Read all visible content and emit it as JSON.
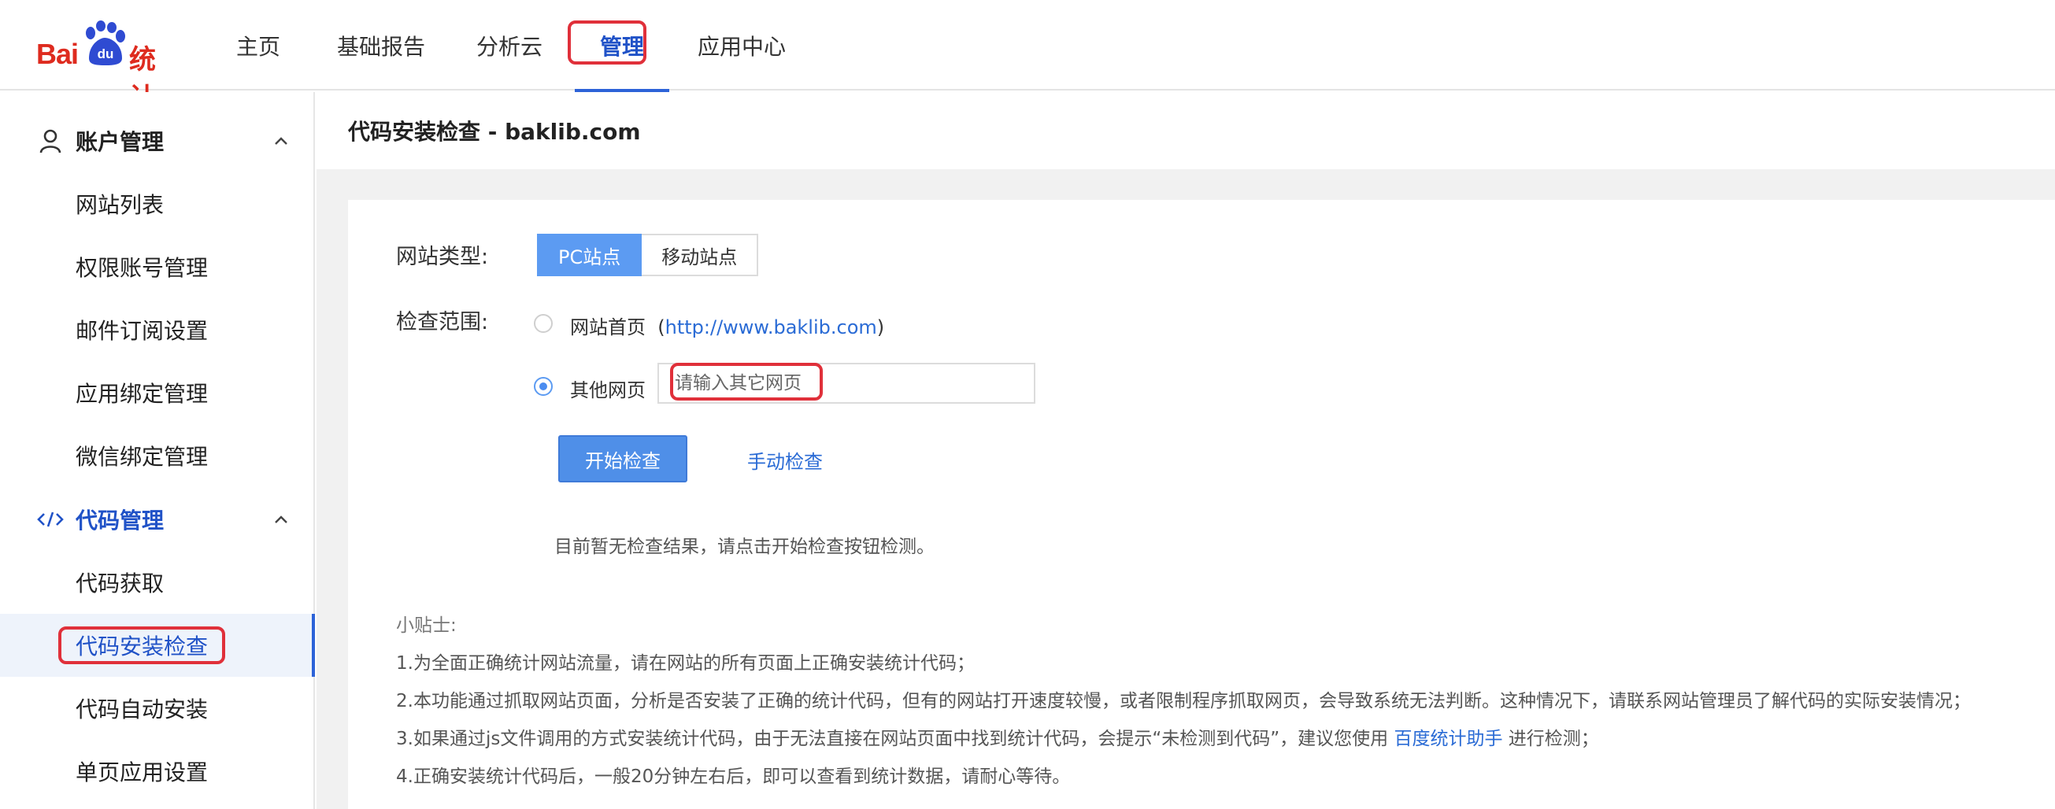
{
  "brand": {
    "logo_text_latin": "Bai",
    "logo_text_du": "du",
    "logo_text_cn": "统计",
    "color": "#de2b1f"
  },
  "nav": {
    "items": [
      {
        "label": "主页"
      },
      {
        "label": "基础报告"
      },
      {
        "label": "分析云"
      },
      {
        "label": "管理",
        "active": true
      },
      {
        "label": "应用中心"
      }
    ]
  },
  "sidebar": {
    "groups": [
      {
        "label": "账户管理",
        "icon": "user-icon",
        "items": [
          {
            "label": "网站列表"
          },
          {
            "label": "权限账号管理"
          },
          {
            "label": "邮件订阅设置"
          },
          {
            "label": "应用绑定管理"
          },
          {
            "label": "微信绑定管理"
          }
        ]
      },
      {
        "label": "代码管理",
        "icon": "code-icon",
        "items": [
          {
            "label": "代码获取"
          },
          {
            "label": "代码安装检查",
            "active": true
          },
          {
            "label": "代码自动安装"
          },
          {
            "label": "单页应用设置"
          }
        ]
      }
    ]
  },
  "page": {
    "title": "代码安装检查 - baklib.com",
    "site_type_label": "网站类型:",
    "site_types": [
      "PC站点",
      "移动站点"
    ],
    "selected_site_type": "PC站点",
    "scope_label": "检查范围:",
    "option_home_label": "网站首页",
    "option_home_url": "http://www.baklib.com",
    "option_other_label": "其他网页",
    "other_input_placeholder": "请输入其它网页",
    "other_input_value": "",
    "selected_scope": "其他网页",
    "start_button": "开始检查",
    "manual_link": "手动检查",
    "result_text": "目前暂无检查结果，请点击开始检查按钮检测。",
    "tips": {
      "title": "小贴士:",
      "lines": [
        "1.为全面正确统计网站流量，请在网站的所有页面上正确安装统计代码；",
        "2.本功能通过抓取网站页面，分析是否安装了正确的统计代码，但有的网站打开速度较慢，或者限制程序抓取网页，会导致系统无法判断。这种情况下，请联系网站管理员了解代码的实际安装情况；",
        "4.正确安装统计代码后，一般20分钟左右后，即可以查看到统计数据，请耐心等待。"
      ],
      "line3_before": "3.如果通过js文件调用的方式安装统计代码，由于无法直接在网站页面中找到统计代码，会提示“未检测到代码”，建议您使用 ",
      "line3_link": "百度统计助手",
      "line3_after": " 进行检测；"
    }
  },
  "colors": {
    "accent": "#2052c7",
    "highlight": "#e0303a",
    "primary_button": "#4f8fe8"
  }
}
